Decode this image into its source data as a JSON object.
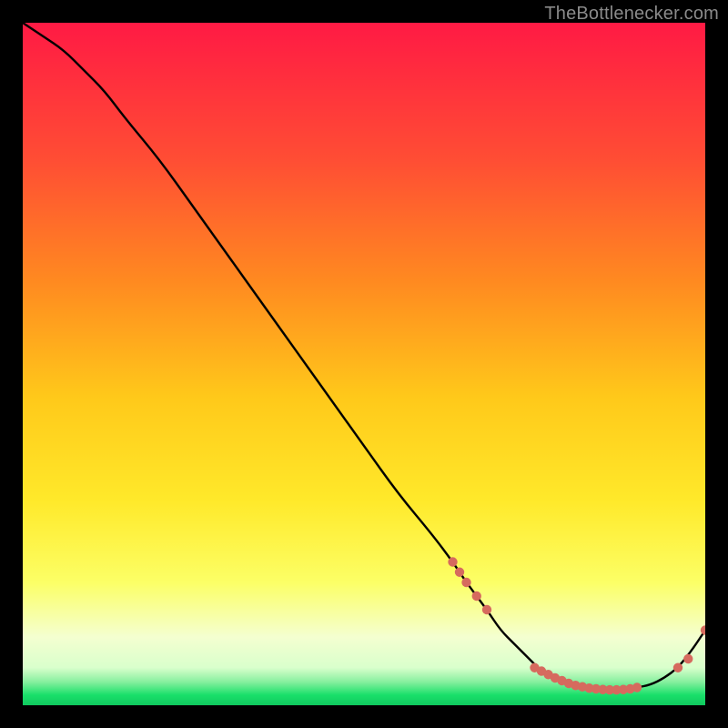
{
  "attribution": "TheBottlenecker.com",
  "colors": {
    "bg_top": "#ff1a44",
    "bg_mid_upper": "#ff7a2a",
    "bg_mid": "#ffd21a",
    "bg_mid_lower": "#fff85a",
    "bg_pale": "#f8ffd8",
    "bg_green": "#19e06a",
    "curve": "#000000",
    "marker": "#d66a5e"
  },
  "chart_data": {
    "type": "line",
    "title": "",
    "xlabel": "",
    "ylabel": "",
    "xlim": [
      0,
      100
    ],
    "ylim": [
      0,
      100
    ],
    "series": [
      {
        "name": "bottleneck-curve",
        "x": [
          0,
          3,
          6,
          9,
          12,
          15,
          20,
          25,
          30,
          35,
          40,
          45,
          50,
          55,
          60,
          63,
          65,
          68,
          70,
          72,
          74,
          76,
          78,
          80,
          82,
          84,
          86,
          88,
          90,
          92,
          94,
          96,
          98,
          100
        ],
        "y": [
          100,
          98,
          96,
          93,
          90,
          86,
          80,
          73,
          66,
          59,
          52,
          45,
          38,
          31,
          25,
          21,
          18,
          14,
          11,
          9,
          7,
          5,
          4,
          3,
          2.5,
          2.3,
          2.2,
          2.3,
          2.6,
          3,
          4,
          5.5,
          8,
          11
        ]
      }
    ],
    "markers": {
      "name": "highlight-points",
      "x": [
        63,
        64,
        65,
        66.5,
        68,
        75,
        76,
        77,
        78,
        79,
        80,
        81,
        82,
        83,
        84,
        85,
        86,
        87,
        88,
        89,
        90,
        96,
        97.5,
        100
      ],
      "y": [
        21,
        19.5,
        18,
        16,
        14,
        5.5,
        5,
        4.5,
        4,
        3.6,
        3.2,
        2.9,
        2.7,
        2.5,
        2.4,
        2.3,
        2.25,
        2.25,
        2.3,
        2.4,
        2.6,
        5.5,
        6.8,
        11
      ]
    },
    "gradient_stops": [
      {
        "pos": 0.0,
        "color": "#ff1a44"
      },
      {
        "pos": 0.2,
        "color": "#ff4d34"
      },
      {
        "pos": 0.38,
        "color": "#ff8a20"
      },
      {
        "pos": 0.55,
        "color": "#ffc91a"
      },
      {
        "pos": 0.7,
        "color": "#ffe92a"
      },
      {
        "pos": 0.82,
        "color": "#fcff66"
      },
      {
        "pos": 0.9,
        "color": "#f4ffd0"
      },
      {
        "pos": 0.945,
        "color": "#d9ffcc"
      },
      {
        "pos": 0.965,
        "color": "#8af0a0"
      },
      {
        "pos": 0.985,
        "color": "#19e06a"
      },
      {
        "pos": 1.0,
        "color": "#10c85e"
      }
    ]
  }
}
